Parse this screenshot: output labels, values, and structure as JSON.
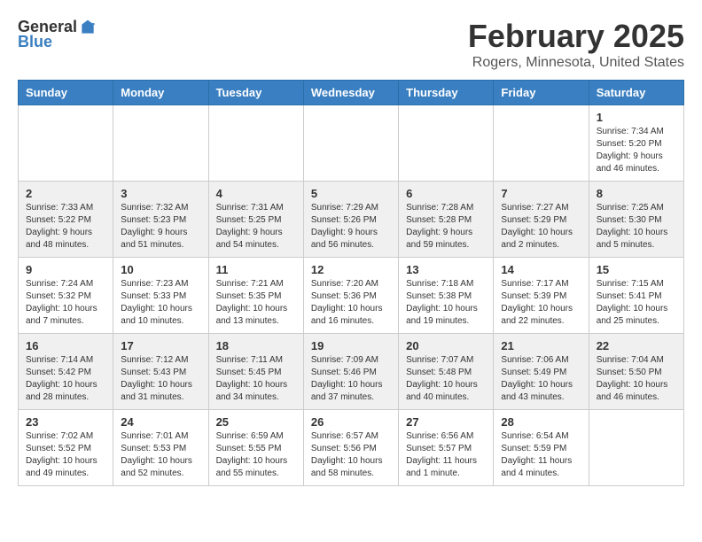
{
  "header": {
    "logo_general": "General",
    "logo_blue": "Blue",
    "month_title": "February 2025",
    "location": "Rogers, Minnesota, United States"
  },
  "days_of_week": [
    "Sunday",
    "Monday",
    "Tuesday",
    "Wednesday",
    "Thursday",
    "Friday",
    "Saturday"
  ],
  "weeks": [
    {
      "days": [
        {
          "number": "",
          "info": ""
        },
        {
          "number": "",
          "info": ""
        },
        {
          "number": "",
          "info": ""
        },
        {
          "number": "",
          "info": ""
        },
        {
          "number": "",
          "info": ""
        },
        {
          "number": "",
          "info": ""
        },
        {
          "number": "1",
          "info": "Sunrise: 7:34 AM\nSunset: 5:20 PM\nDaylight: 9 hours and 46 minutes."
        }
      ]
    },
    {
      "days": [
        {
          "number": "2",
          "info": "Sunrise: 7:33 AM\nSunset: 5:22 PM\nDaylight: 9 hours and 48 minutes."
        },
        {
          "number": "3",
          "info": "Sunrise: 7:32 AM\nSunset: 5:23 PM\nDaylight: 9 hours and 51 minutes."
        },
        {
          "number": "4",
          "info": "Sunrise: 7:31 AM\nSunset: 5:25 PM\nDaylight: 9 hours and 54 minutes."
        },
        {
          "number": "5",
          "info": "Sunrise: 7:29 AM\nSunset: 5:26 PM\nDaylight: 9 hours and 56 minutes."
        },
        {
          "number": "6",
          "info": "Sunrise: 7:28 AM\nSunset: 5:28 PM\nDaylight: 9 hours and 59 minutes."
        },
        {
          "number": "7",
          "info": "Sunrise: 7:27 AM\nSunset: 5:29 PM\nDaylight: 10 hours and 2 minutes."
        },
        {
          "number": "8",
          "info": "Sunrise: 7:25 AM\nSunset: 5:30 PM\nDaylight: 10 hours and 5 minutes."
        }
      ]
    },
    {
      "days": [
        {
          "number": "9",
          "info": "Sunrise: 7:24 AM\nSunset: 5:32 PM\nDaylight: 10 hours and 7 minutes."
        },
        {
          "number": "10",
          "info": "Sunrise: 7:23 AM\nSunset: 5:33 PM\nDaylight: 10 hours and 10 minutes."
        },
        {
          "number": "11",
          "info": "Sunrise: 7:21 AM\nSunset: 5:35 PM\nDaylight: 10 hours and 13 minutes."
        },
        {
          "number": "12",
          "info": "Sunrise: 7:20 AM\nSunset: 5:36 PM\nDaylight: 10 hours and 16 minutes."
        },
        {
          "number": "13",
          "info": "Sunrise: 7:18 AM\nSunset: 5:38 PM\nDaylight: 10 hours and 19 minutes."
        },
        {
          "number": "14",
          "info": "Sunrise: 7:17 AM\nSunset: 5:39 PM\nDaylight: 10 hours and 22 minutes."
        },
        {
          "number": "15",
          "info": "Sunrise: 7:15 AM\nSunset: 5:41 PM\nDaylight: 10 hours and 25 minutes."
        }
      ]
    },
    {
      "days": [
        {
          "number": "16",
          "info": "Sunrise: 7:14 AM\nSunset: 5:42 PM\nDaylight: 10 hours and 28 minutes."
        },
        {
          "number": "17",
          "info": "Sunrise: 7:12 AM\nSunset: 5:43 PM\nDaylight: 10 hours and 31 minutes."
        },
        {
          "number": "18",
          "info": "Sunrise: 7:11 AM\nSunset: 5:45 PM\nDaylight: 10 hours and 34 minutes."
        },
        {
          "number": "19",
          "info": "Sunrise: 7:09 AM\nSunset: 5:46 PM\nDaylight: 10 hours and 37 minutes."
        },
        {
          "number": "20",
          "info": "Sunrise: 7:07 AM\nSunset: 5:48 PM\nDaylight: 10 hours and 40 minutes."
        },
        {
          "number": "21",
          "info": "Sunrise: 7:06 AM\nSunset: 5:49 PM\nDaylight: 10 hours and 43 minutes."
        },
        {
          "number": "22",
          "info": "Sunrise: 7:04 AM\nSunset: 5:50 PM\nDaylight: 10 hours and 46 minutes."
        }
      ]
    },
    {
      "days": [
        {
          "number": "23",
          "info": "Sunrise: 7:02 AM\nSunset: 5:52 PM\nDaylight: 10 hours and 49 minutes."
        },
        {
          "number": "24",
          "info": "Sunrise: 7:01 AM\nSunset: 5:53 PM\nDaylight: 10 hours and 52 minutes."
        },
        {
          "number": "25",
          "info": "Sunrise: 6:59 AM\nSunset: 5:55 PM\nDaylight: 10 hours and 55 minutes."
        },
        {
          "number": "26",
          "info": "Sunrise: 6:57 AM\nSunset: 5:56 PM\nDaylight: 10 hours and 58 minutes."
        },
        {
          "number": "27",
          "info": "Sunrise: 6:56 AM\nSunset: 5:57 PM\nDaylight: 11 hours and 1 minute."
        },
        {
          "number": "28",
          "info": "Sunrise: 6:54 AM\nSunset: 5:59 PM\nDaylight: 11 hours and 4 minutes."
        },
        {
          "number": "",
          "info": ""
        }
      ]
    }
  ]
}
